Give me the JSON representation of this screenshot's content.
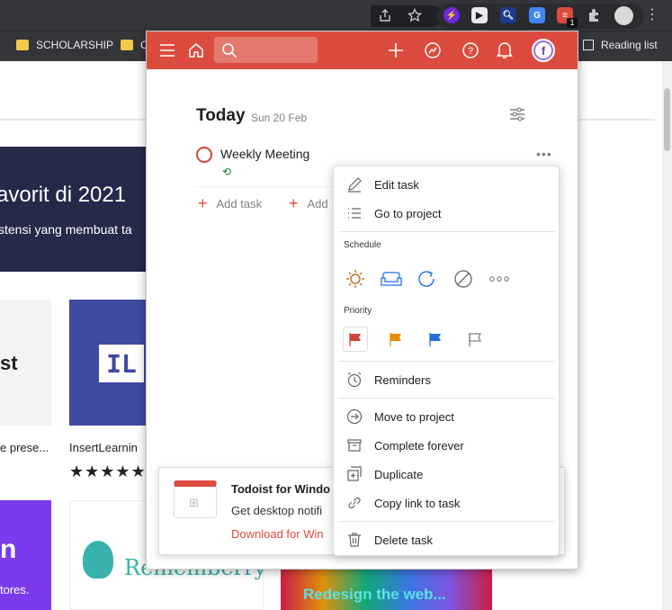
{
  "browser": {
    "bookmarks": [
      {
        "label": "SCHOLARSHIP"
      },
      {
        "label": "C"
      }
    ],
    "reading_list": "Reading list",
    "todoist_badge": "1"
  },
  "background": {
    "banner_line1": "avorit di 2021",
    "banner_line2": "stensi yang membuat ta",
    "card1_text": "st",
    "card1_caption": "e prese...",
    "card2_logo": "IL",
    "card2_caption": "InsertLearnin",
    "card2_stars": "★★★★★",
    "card3_big": "n",
    "card3_small": "tores.",
    "card4_text": "Rememberry",
    "card5_text": "Redesign the web..."
  },
  "todoist": {
    "search_placeholder": "",
    "avatar_letter": "f",
    "title": "Today",
    "date": "Sun 20 Feb",
    "task": {
      "name": "Weekly Meeting",
      "recurring_icon": "⟲"
    },
    "add_task_label": "Add task",
    "add_task_label2": "Add",
    "toast": {
      "title": "Todoist for Windo",
      "body": "Get desktop notifi",
      "link": "Download for Win"
    },
    "menu": {
      "edit": "Edit task",
      "goto": "Go to project",
      "schedule_heading": "Schedule",
      "priority_heading": "Priority",
      "reminders": "Reminders",
      "move": "Move to project",
      "complete": "Complete forever",
      "duplicate": "Duplicate",
      "copy_link": "Copy link to task",
      "delete": "Delete task"
    }
  },
  "colors": {
    "brand": "#db4c3f",
    "p1": "#d1453b",
    "p2": "#eb8909",
    "p3": "#246fe0",
    "p4": "#808080"
  }
}
